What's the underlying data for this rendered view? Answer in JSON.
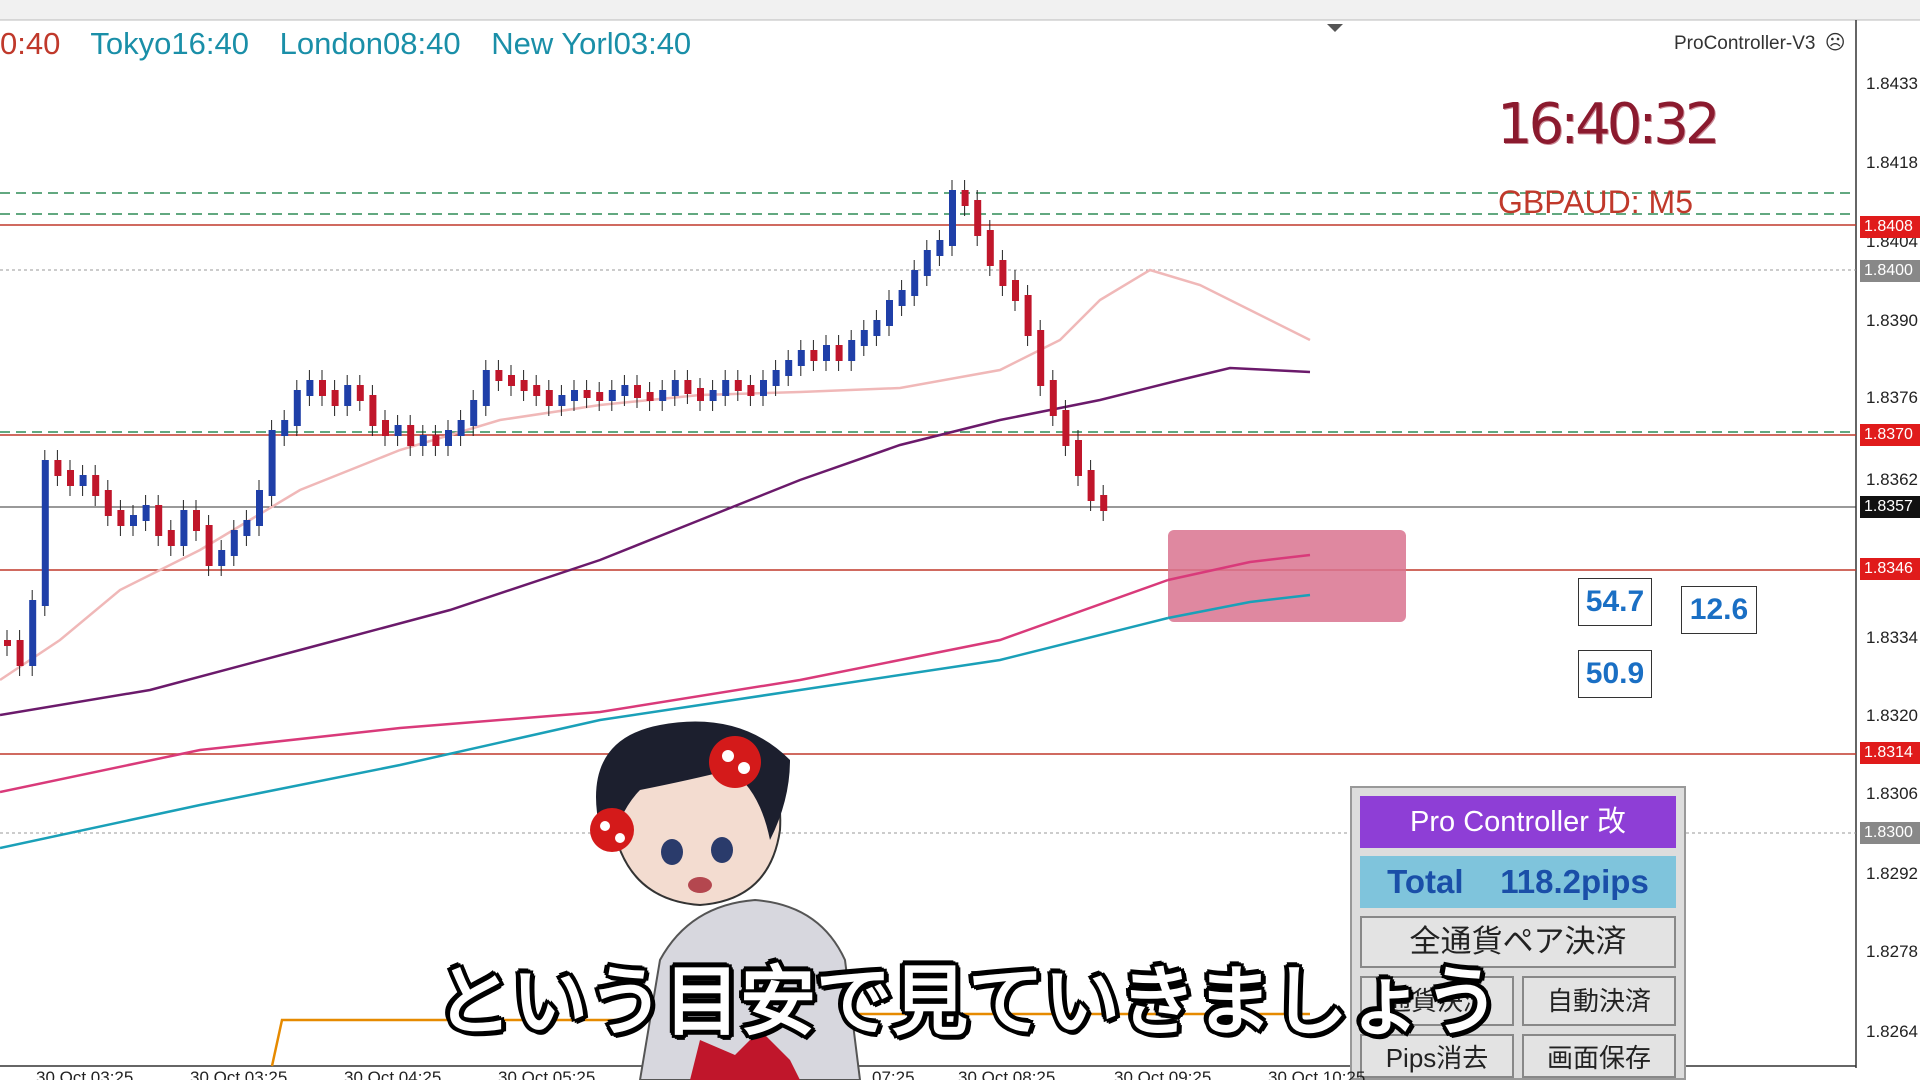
{
  "sessions": {
    "first_time": "0:40",
    "tokyo": "Tokyo16:40",
    "london": "London08:40",
    "newyork": "New Yorl03:40"
  },
  "indicator_title": "ProController-V3",
  "clock": "16:40:32",
  "symbol": "GBPAUD: M5",
  "price_axis": {
    "labels": [
      "1.8433",
      "1.8418",
      "1.8404",
      "1.8390",
      "1.8376",
      "1.8362",
      "1.8334",
      "1.8320",
      "1.8306",
      "1.8292",
      "1.8278",
      "1.8264"
    ],
    "tags": [
      {
        "text": "1.8408",
        "color": "#e01b1b"
      },
      {
        "text": "1.8400",
        "color": "#888888"
      },
      {
        "text": "1.8370",
        "color": "#e01b1b"
      },
      {
        "text": "1.8357",
        "color": "#111111"
      },
      {
        "text": "1.8346",
        "color": "#e01b1b"
      },
      {
        "text": "1.8314",
        "color": "#e01b1b"
      },
      {
        "text": "1.8300",
        "color": "#888888"
      }
    ]
  },
  "pips_boxes": {
    "a": "54.7",
    "b": "12.6",
    "c": "50.9"
  },
  "panel": {
    "title": "Pro Controller 改",
    "total": "Total    118.2pips",
    "close_all": "全通貨ペア決済",
    "partial_close": "通貨決済",
    "auto_close": "自動決済",
    "pips_clear": "Pips消去",
    "save_screen": "画面保存"
  },
  "subtitle": "という目安で見ていきましょう",
  "time_axis": [
    "30 Oct 03:25",
    "30 Oct 03:25",
    "30 Oct 04:25",
    "30 Oct 05:25",
    "07:25",
    "30 Oct 08:25",
    "30 Oct 09:25",
    "30 Oct 10:25"
  ],
  "colors": {
    "bull": "#1f3fa8",
    "bear": "#c0162b",
    "zone": "#d9738f",
    "ma_fast": "#f0b8b8",
    "ma_mid": "#6b1a6b",
    "ma_slow": "#d93a7a",
    "ma_long": "#1aa0b8"
  }
}
